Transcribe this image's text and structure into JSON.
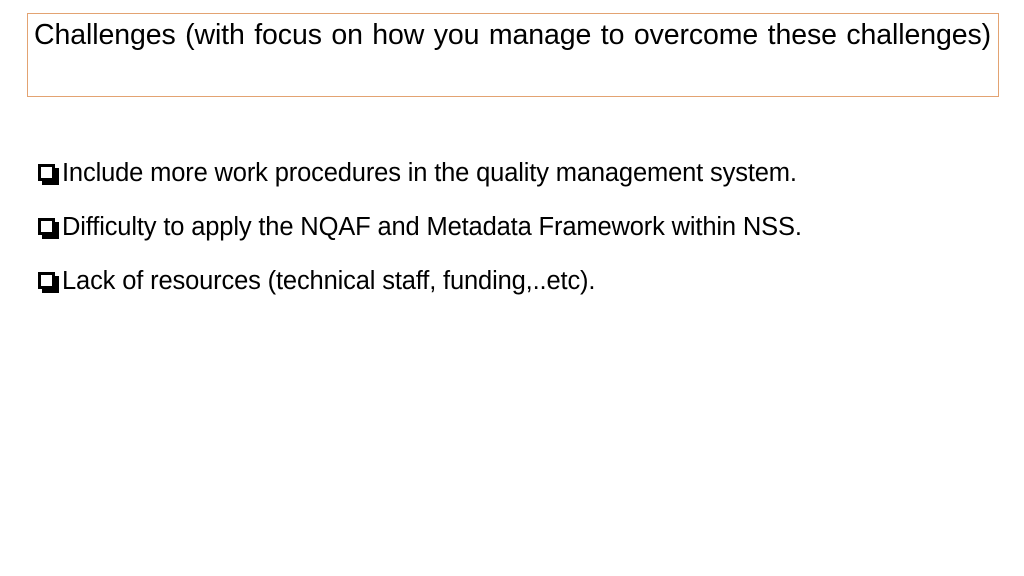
{
  "slide": {
    "background_color": "#FFFFFF",
    "title": {
      "text": "Challenges (with focus on how you manage to overcome these challenges)",
      "border_color": "#E3A372",
      "text_color": "#000000"
    },
    "bullets": [
      {
        "marker": "hollow-square-bullet",
        "text": "Include more work procedures in the quality management system."
      },
      {
        "marker": "hollow-square-bullet",
        "text": "Difficulty to apply the NQAF and Metadata Framework within NSS."
      },
      {
        "marker": "hollow-square-bullet",
        "text": "Lack of resources (technical staff, funding,..etc)."
      }
    ]
  }
}
